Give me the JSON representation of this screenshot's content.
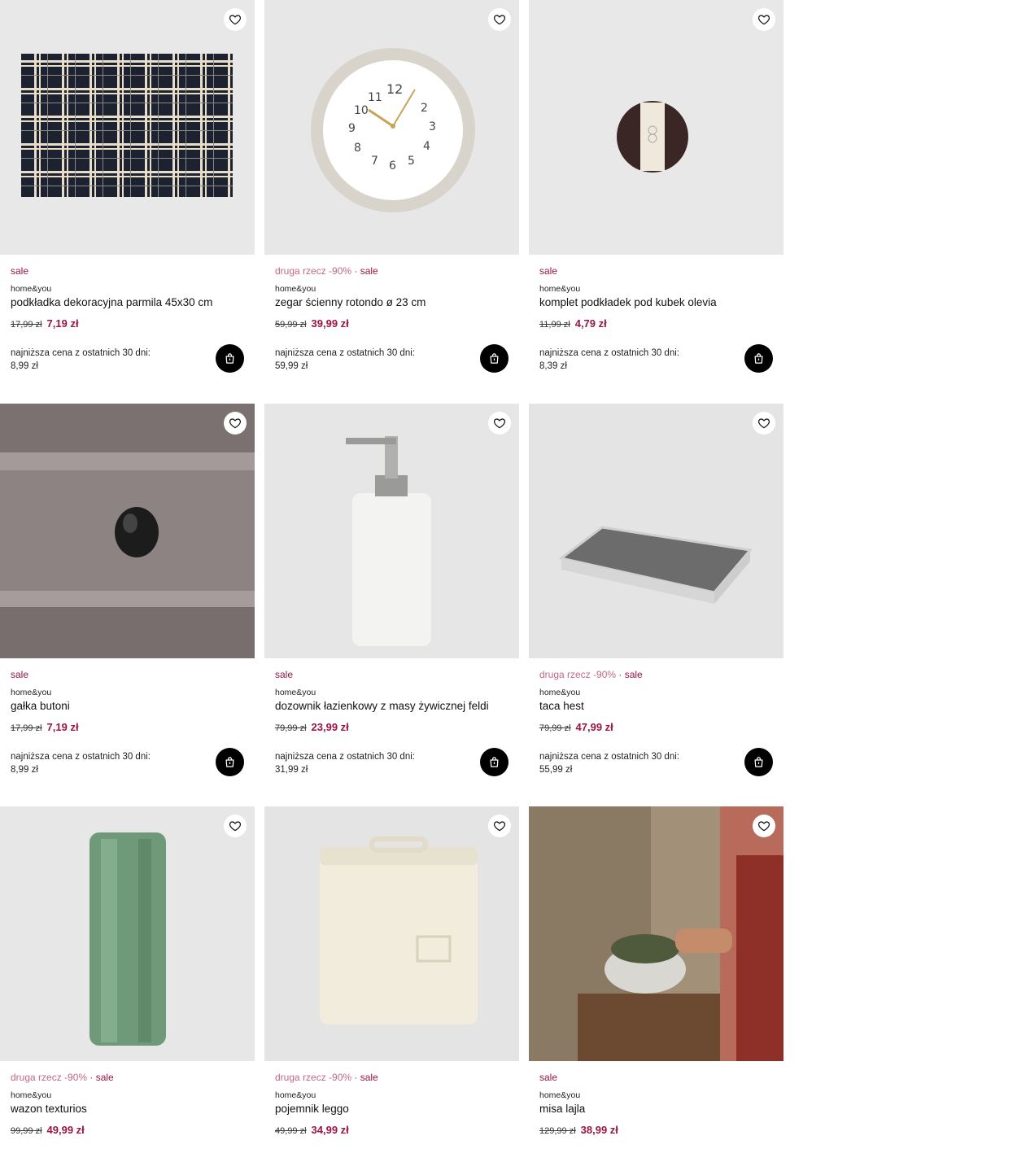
{
  "products": [
    {
      "promo": "",
      "sale": "sale",
      "brand": "home&you",
      "name": "podkładka dekoracyjna parmila 45x30 cm",
      "old_price": "17,99 zł",
      "new_price": "7,19 zł",
      "lowest_label": "najniższa cena z ostatnich 30 dni:",
      "lowest_value": "8,99 zł",
      "bg": "#e8e8e8"
    },
    {
      "promo": "druga rzecz -90%",
      "sale": "sale",
      "brand": "home&you",
      "name": "zegar ścienny rotondo ø 23 cm",
      "old_price": "59,99 zł",
      "new_price": "39,99 zł",
      "lowest_label": "najniższa cena z ostatnich 30 dni:",
      "lowest_value": "59,99 zł",
      "bg": "#e7e7e7"
    },
    {
      "promo": "",
      "sale": "sale",
      "brand": "home&you",
      "name": "komplet podkładek pod kubek olevia",
      "old_price": "11,99 zł",
      "new_price": "4,79 zł",
      "lowest_label": "najniższa cena z ostatnich 30 dni:",
      "lowest_value": "8,39 zł",
      "bg": "#e8e8e8"
    },
    {
      "promo": "",
      "sale": "sale",
      "brand": "home&you",
      "name": "gałka butoni",
      "old_price": "17,99 zł",
      "new_price": "7,19 zł",
      "lowest_label": "najniższa cena z ostatnich 30 dni:",
      "lowest_value": "8,99 zł",
      "bg": "#8e8584"
    },
    {
      "promo": "",
      "sale": "sale",
      "brand": "home&you",
      "name": "dozownik łazienkowy z masy żywicznej feldi",
      "old_price": "79,99 zł",
      "new_price": "23,99 zł",
      "lowest_label": "najniższa cena z ostatnich 30 dni:",
      "lowest_value": "31,99 zł",
      "bg": "#e6e6e6"
    },
    {
      "promo": "druga rzecz -90%",
      "sale": "sale",
      "brand": "home&you",
      "name": "taca hest",
      "old_price": "79,99 zł",
      "new_price": "47,99 zł",
      "lowest_label": "najniższa cena z ostatnich 30 dni:",
      "lowest_value": "55,99 zł",
      "bg": "#e4e4e4"
    },
    {
      "promo": "druga rzecz -90%",
      "sale": "sale",
      "brand": "home&you",
      "name": "wazon texturios",
      "old_price": "99,99 zł",
      "new_price": "49,99 zł",
      "lowest_label": "",
      "lowest_value": "",
      "bg": "#e7e7e7"
    },
    {
      "promo": "druga rzecz -90%",
      "sale": "sale",
      "brand": "home&you",
      "name": "pojemnik leggo",
      "old_price": "49,99 zł",
      "new_price": "34,99 zł",
      "lowest_label": "",
      "lowest_value": "",
      "bg": "#e4e4e4"
    },
    {
      "promo": "",
      "sale": "sale",
      "brand": "home&you",
      "name": "misa lajla",
      "old_price": "129,99 zł",
      "new_price": "38,99 zł",
      "lowest_label": "",
      "lowest_value": "",
      "bg": "#9a8a74"
    }
  ],
  "icons": {
    "favorite": "heart-outline-icon",
    "cart": "shopping-bag-icon"
  },
  "colors": {
    "sale": "#9a1445",
    "promo": "#c2678a",
    "cart_button": "#000000"
  }
}
